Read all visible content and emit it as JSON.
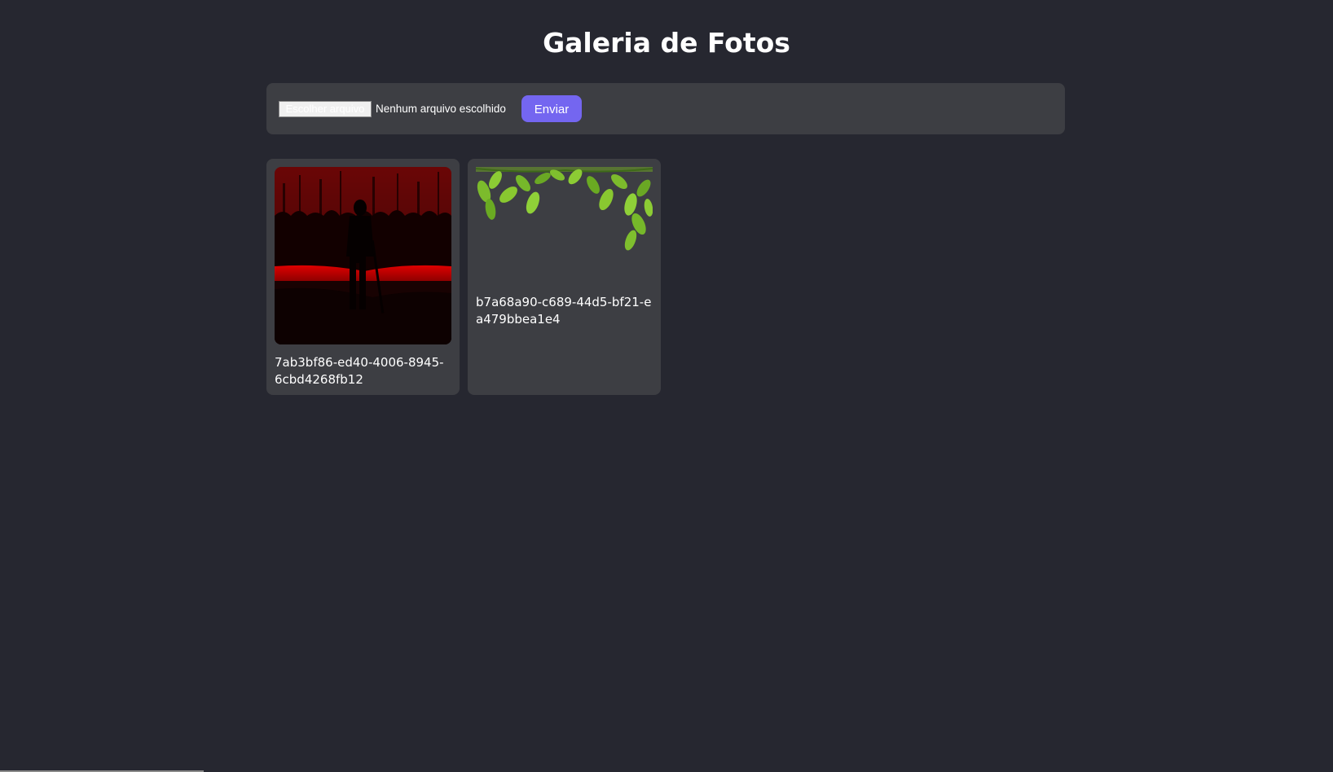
{
  "page": {
    "title": "Galeria de Fotos"
  },
  "upload": {
    "file_button_label": "Escolher arquivo",
    "file_status": "Nenhum arquivo escolhido",
    "send_label": "Enviar"
  },
  "photos": [
    {
      "caption": "7ab3bf86-ed40-4006-8945-6cbd4268fb12"
    },
    {
      "caption": "b7a68a90-c689-44d5-bf21-ea479bbea1e4"
    }
  ],
  "colors": {
    "background": "#262730",
    "panel": "#3d3e43",
    "accent": "#7466f0"
  }
}
